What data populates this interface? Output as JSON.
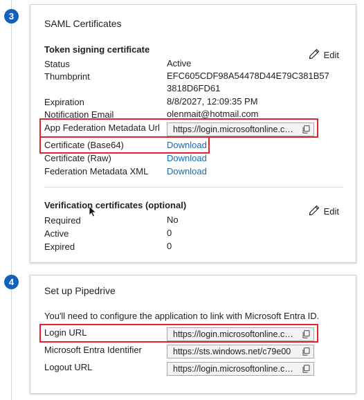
{
  "steps": {
    "saml": "3",
    "setup": "4"
  },
  "saml": {
    "title": "SAML Certificates",
    "token_section": {
      "title": "Token signing certificate",
      "edit_label": "Edit",
      "status_label": "Status",
      "status_value": "Active",
      "thumbprint_label": "Thumbprint",
      "thumbprint_line1": "EFC605CDF98A54478D44E79C381B57",
      "thumbprint_line2": "3818D6FD61",
      "expiration_label": "Expiration",
      "expiration_value": "8/8/2027, 12:09:35 PM",
      "email_label": "Notification Email",
      "email_value": "olenmait@hotmail.com",
      "metadata_url_label": "App Federation Metadata Url",
      "metadata_url_value": "https://login.microsoftonline.com/",
      "cert_base64_label": "Certificate (Base64)",
      "cert_base64_link": "Download",
      "cert_raw_label": "Certificate (Raw)",
      "cert_raw_link": "Download",
      "fed_xml_label": "Federation Metadata XML",
      "fed_xml_link": "Download"
    },
    "verification_section": {
      "title": "Verification certificates (optional)",
      "edit_label": "Edit",
      "required_label": "Required",
      "required_value": "No",
      "active_label": "Active",
      "active_value": "0",
      "expired_label": "Expired",
      "expired_value": "0"
    }
  },
  "setup": {
    "title": "Set up Pipedrive",
    "description": "You'll need to configure the application to link with Microsoft Entra ID.",
    "login_url_label": "Login URL",
    "login_url_value": "https://login.microsoftonline.com/",
    "entra_id_label": "Microsoft Entra Identifier",
    "entra_id_value": "https://sts.windows.net/c79e00",
    "logout_url_label": "Logout URL",
    "logout_url_value": "https://login.microsoftonline.com/"
  },
  "colors": {
    "accent": "#0f6cbd",
    "step_badge": "#1560bd",
    "highlight": "#e5222a"
  },
  "icons": {
    "edit": "pencil-icon",
    "copy": "copy-icon",
    "cursor": "mouse-pointer-icon"
  }
}
